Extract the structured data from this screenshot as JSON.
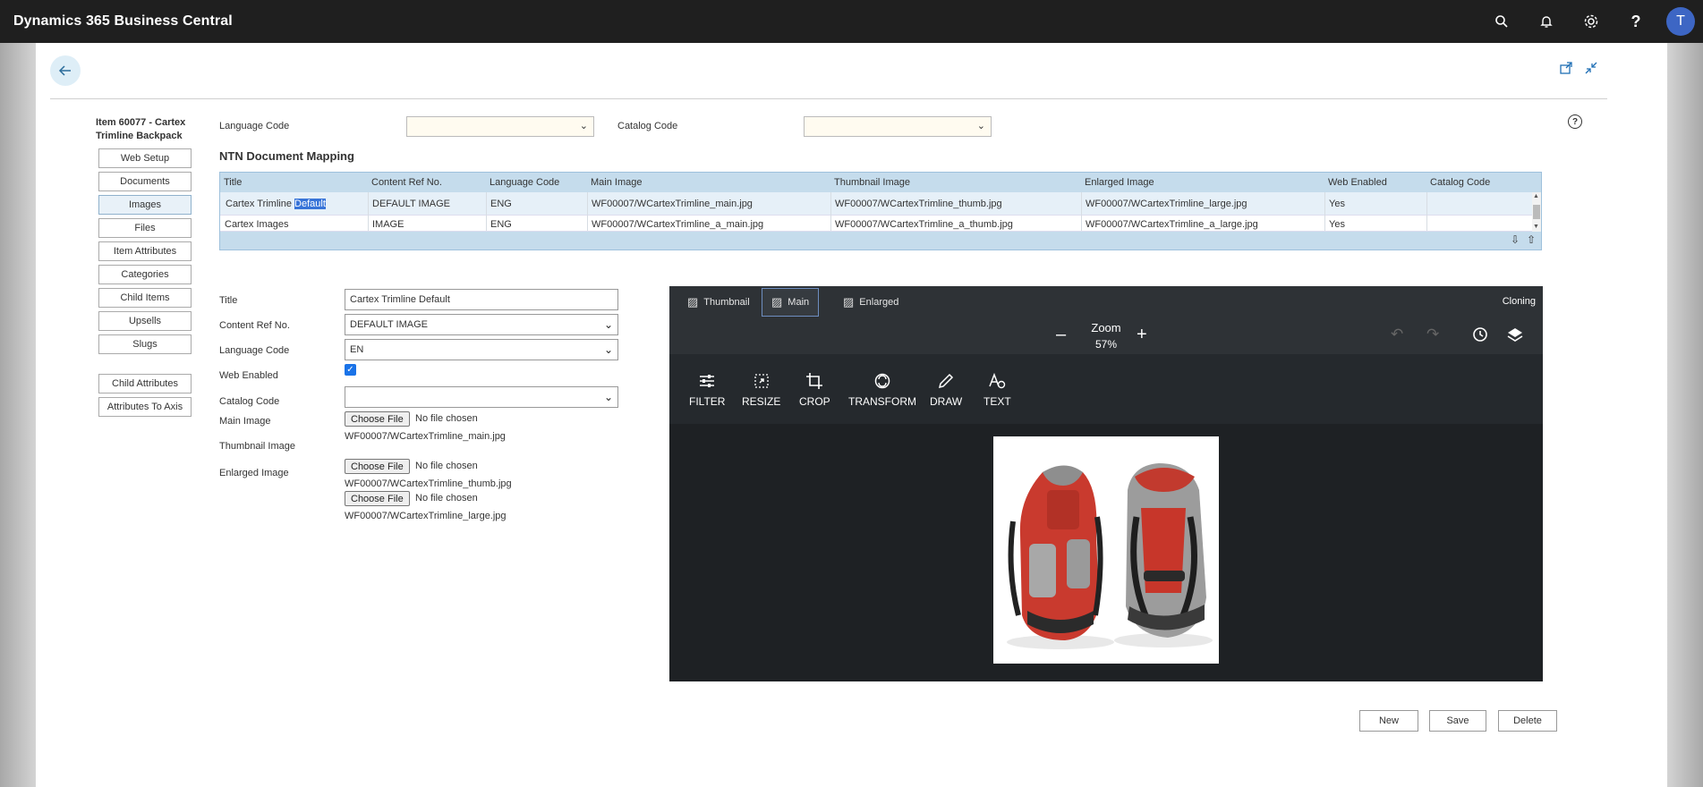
{
  "app": {
    "title": "Dynamics 365 Business Central",
    "user_initial": "T"
  },
  "item": {
    "title": "Item 60077 - Cartex Trimline Backpack"
  },
  "nav": {
    "items": [
      "Web Setup",
      "Documents",
      "Images",
      "Files",
      "Item Attributes",
      "Categories",
      "Child Items",
      "Upsells",
      "Slugs"
    ],
    "extra": [
      "Child Attributes",
      "Attributes To Axis"
    ],
    "active": "Images"
  },
  "filters": {
    "language_label": "Language Code",
    "catalog_label": "Catalog Code",
    "language_value": "",
    "catalog_value": ""
  },
  "section": {
    "title": "NTN Document Mapping"
  },
  "grid": {
    "columns": [
      "Title",
      "Content Ref No.",
      "Language Code",
      "Main Image",
      "Thumbnail Image",
      "Enlarged Image",
      "Web Enabled",
      "Catalog Code"
    ],
    "rows": [
      {
        "title_a": "Cartex Trimline ",
        "title_b": "Default",
        "ref": "DEFAULT IMAGE",
        "lang": "ENG",
        "main": "WF00007/WCartexTrimline_main.jpg",
        "thumb": "WF00007/WCartexTrimline_thumb.jpg",
        "large": "WF00007/WCartexTrimline_large.jpg",
        "web": "Yes",
        "catalog": ""
      },
      {
        "title_a": "Cartex Images",
        "title_b": "",
        "ref": "IMAGE",
        "lang": "ENG",
        "main": "WF00007/WCartexTrimline_a_main.jpg",
        "thumb": "WF00007/WCartexTrimline_a_thumb.jpg",
        "large": "WF00007/WCartexTrimline_a_large.jpg",
        "web": "Yes",
        "catalog": ""
      }
    ]
  },
  "form": {
    "title_label": "Title",
    "title_value": "Cartex Trimline Default",
    "ref_label": "Content Ref No.",
    "ref_value": "DEFAULT IMAGE",
    "lang_label": "Language Code",
    "lang_value": "EN",
    "web_label": "Web Enabled",
    "catalog_label": "Catalog Code",
    "catalog_value": "",
    "main_label": "Main Image",
    "thumb_label": "Thumbnail Image",
    "enlarged_label": "Enlarged Image",
    "choose_file": "Choose File",
    "no_file": "No file chosen",
    "main_file": "WF00007/WCartexTrimline_main.jpg",
    "thumb_file": "WF00007/WCartexTrimline_thumb.jpg",
    "large_file": "WF00007/WCartexTrimline_large.jpg"
  },
  "editor": {
    "tabs": [
      "Thumbnail",
      "Main",
      "Enlarged"
    ],
    "active_tab": "Main",
    "cloning": "Cloning",
    "zoom_label": "Zoom",
    "zoom_value": "57%",
    "tools": [
      "FILTER",
      "RESIZE",
      "CROP",
      "TRANSFORM",
      "DRAW",
      "TEXT"
    ]
  },
  "actions": {
    "new": "New",
    "save": "Save",
    "delete": "Delete"
  }
}
